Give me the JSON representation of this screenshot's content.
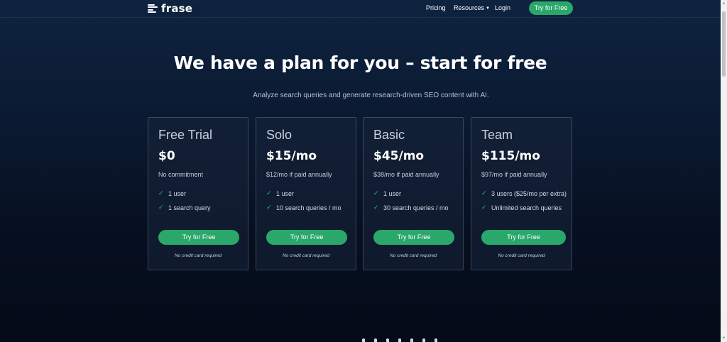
{
  "nav": {
    "logo_text": "frase",
    "links": [
      "Pricing",
      "Resources",
      "Login"
    ],
    "cta_label": "Try for Free"
  },
  "hero": {
    "title": "We have a plan for you – start for free",
    "subtitle": "Analyze search queries and generate research-driven SEO content with AI."
  },
  "plans": [
    {
      "name": "Free Trial",
      "price": "$0",
      "note": "No commitment",
      "features": [
        "1 user",
        "1 search query"
      ],
      "button_label": "Try for Free",
      "footnote": "No credit card required"
    },
    {
      "name": "Solo",
      "price": "$15/mo",
      "note": "$12/mo if paid annually",
      "features": [
        "1 user",
        "10 search queries / mo"
      ],
      "button_label": "Try for Free",
      "footnote": "No credit card required"
    },
    {
      "name": "Basic",
      "price": "$45/mo",
      "note": "$38/mo if paid annually",
      "features": [
        "1 user",
        "30 search queries / mo"
      ],
      "button_label": "Try for Free",
      "footnote": "No credit card required"
    },
    {
      "name": "Team",
      "price": "$115/mo",
      "note": "$97/mo if paid annually",
      "features": [
        "3 users ($25/mo per extra)",
        "Unlimited search queries"
      ],
      "button_label": "Try for Free",
      "footnote": "No credit card required"
    }
  ],
  "icons": {
    "logo": "frase-logo-icon",
    "dropdown": "chevron-down-icon",
    "feature_check": "check-icon"
  },
  "colors": {
    "accent": "#2aa86c",
    "check": "#2fb67a",
    "background_top": "#0e2340",
    "background_bottom": "#040b18"
  }
}
